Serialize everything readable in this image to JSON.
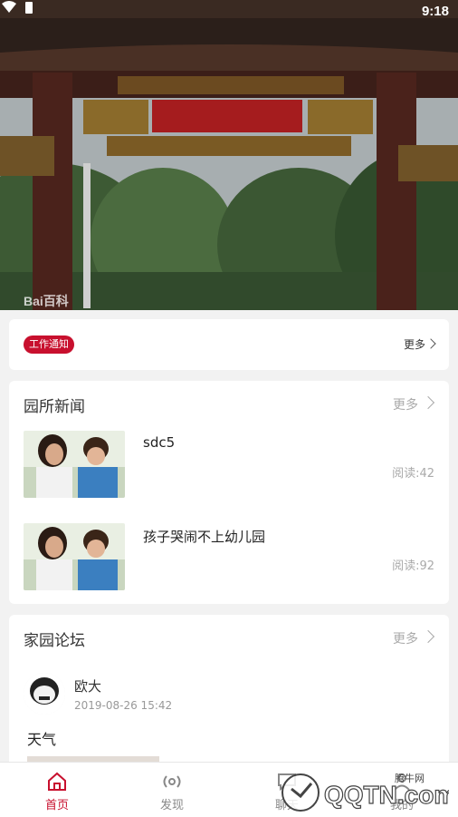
{
  "status": {
    "time": "9:18"
  },
  "banner": {
    "watermark": "Bai百科"
  },
  "notice": {
    "tag": "工作通知",
    "more": "更多"
  },
  "news": {
    "title": "园所新闻",
    "more": "更多",
    "items": [
      {
        "title": "sdc5",
        "reads": "阅读:42"
      },
      {
        "title": "孩子哭闹不上幼儿园",
        "reads": "阅读:92"
      }
    ]
  },
  "forum": {
    "title": "家园论坛",
    "more": "更多",
    "post": {
      "author": "欧大",
      "date": "2019-08-26 15:42",
      "title": "天气"
    }
  },
  "tabs": [
    {
      "label": "首页",
      "icon": "home-icon",
      "active": true
    },
    {
      "label": "发现",
      "icon": "broadcast-icon",
      "active": false
    },
    {
      "label": "聊天",
      "icon": "chat-icon",
      "active": false
    },
    {
      "label": "我的",
      "icon": "user-icon",
      "active": false
    }
  ],
  "brand_watermark": {
    "text": "QQTN.com",
    "cn": "腾牛网"
  },
  "colors": {
    "accent": "#c8102e",
    "background": "#f2f2f2"
  }
}
